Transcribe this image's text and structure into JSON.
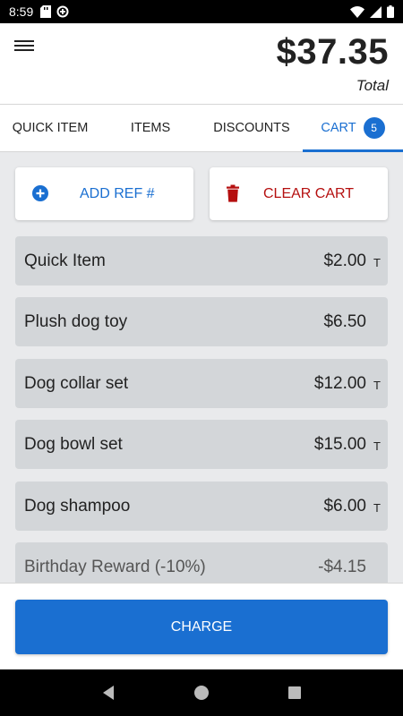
{
  "status_bar": {
    "time": "8:59",
    "icons": [
      "sd-card-icon",
      "data-saver-icon",
      "wifi-icon",
      "signal-icon",
      "battery-icon"
    ]
  },
  "header": {
    "menu_icon": "hamburger-menu-icon",
    "total_amount": "$37.35",
    "total_label": "Total"
  },
  "tabs": [
    {
      "label": "QUICK ITEM",
      "active": false
    },
    {
      "label": "ITEMS",
      "active": false
    },
    {
      "label": "DISCOUNTS",
      "active": false
    },
    {
      "label": "CART",
      "active": true,
      "badge": "5"
    }
  ],
  "actions": {
    "add_ref": {
      "label": "ADD REF #",
      "icon": "plus-circle-icon"
    },
    "clear_cart": {
      "label": "CLEAR CART",
      "icon": "trash-icon"
    }
  },
  "cart_items": [
    {
      "name": "Quick Item",
      "price": "$2.00",
      "tax": "T"
    },
    {
      "name": "Plush dog toy",
      "price": "$6.50",
      "tax": ""
    },
    {
      "name": "Dog collar set",
      "price": "$12.00",
      "tax": "T"
    },
    {
      "name": "Dog bowl set",
      "price": "$15.00",
      "tax": "T"
    },
    {
      "name": "Dog shampoo",
      "price": "$6.00",
      "tax": "T"
    },
    {
      "name": "Birthday Reward (-10%)",
      "price": "-$4.15",
      "tax": ""
    }
  ],
  "charge_button": {
    "label": "CHARGE"
  },
  "colors": {
    "accent": "#1a6fd1",
    "danger": "#b50f0f",
    "row_bg": "#d3d6d9",
    "list_bg": "#e9eaec"
  }
}
